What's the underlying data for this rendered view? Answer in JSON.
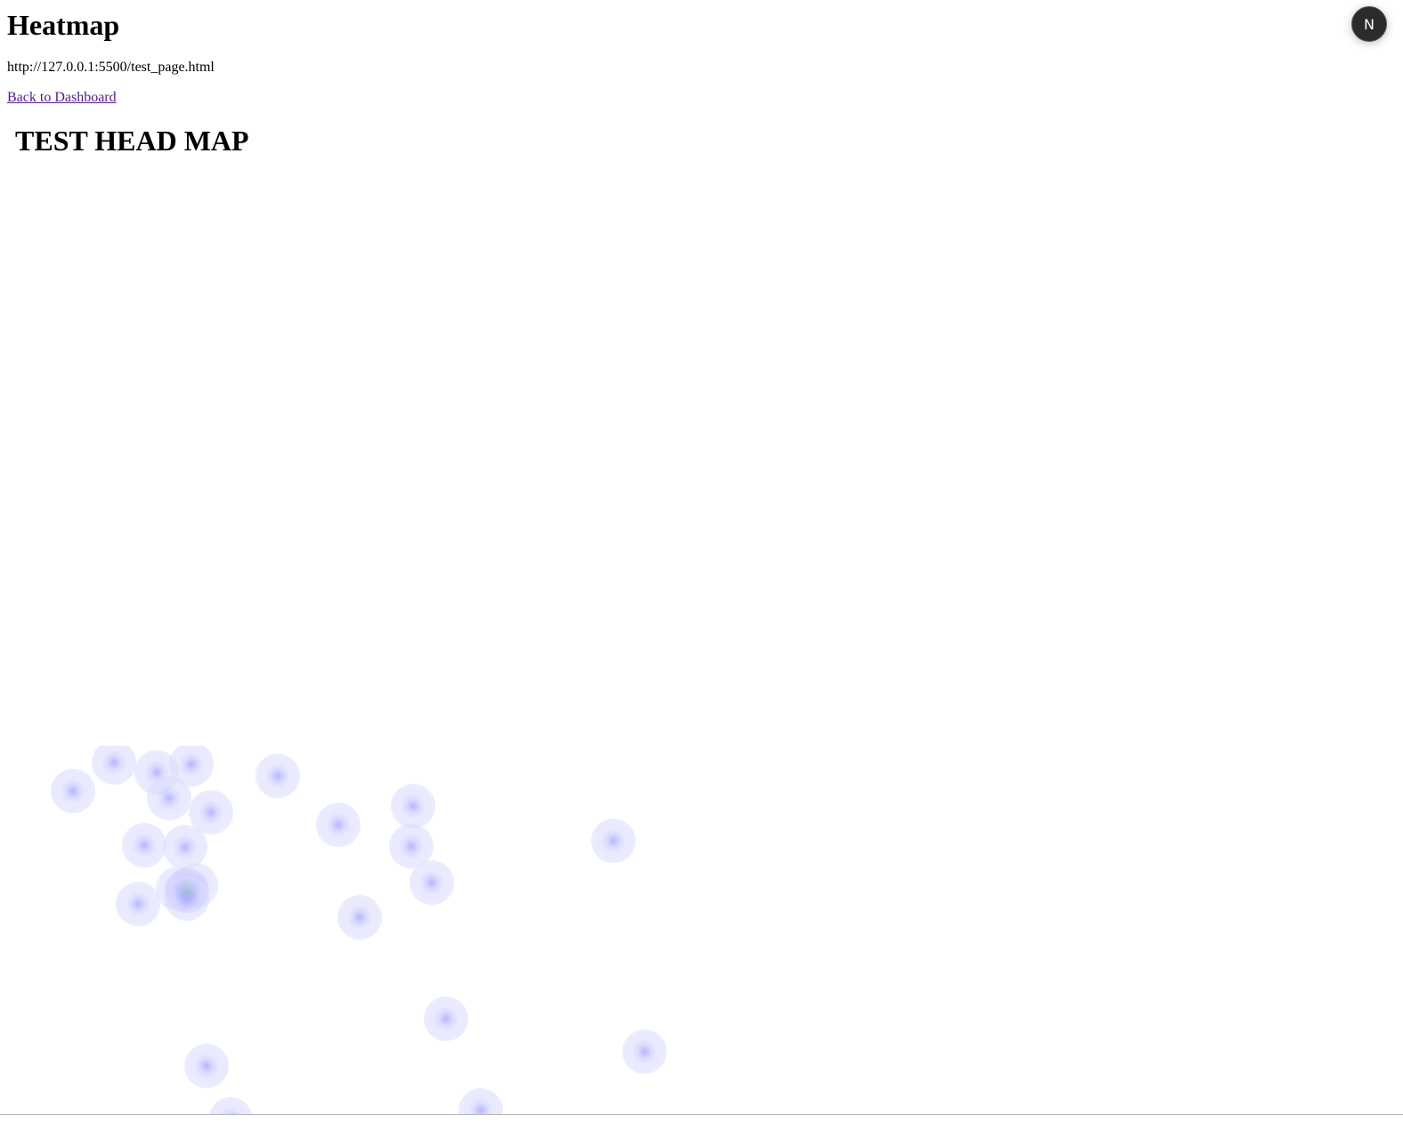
{
  "header": {
    "title": "Heatmap",
    "url": "http://127.0.0.1:5500/test_page.html",
    "back_link_label": "Back to Dashboard"
  },
  "frame": {
    "heading": "TEST HEAD MAP"
  },
  "heatmap": {
    "point_count": 26
  },
  "dev_badge": {
    "letter": "N",
    "icon": "nextjs-icon"
  },
  "colors": {
    "link": "#551a8b",
    "heat_point": "#dcdcff",
    "heat_hot": "#6ebe96",
    "badge_bg": "#2b2b2b"
  }
}
